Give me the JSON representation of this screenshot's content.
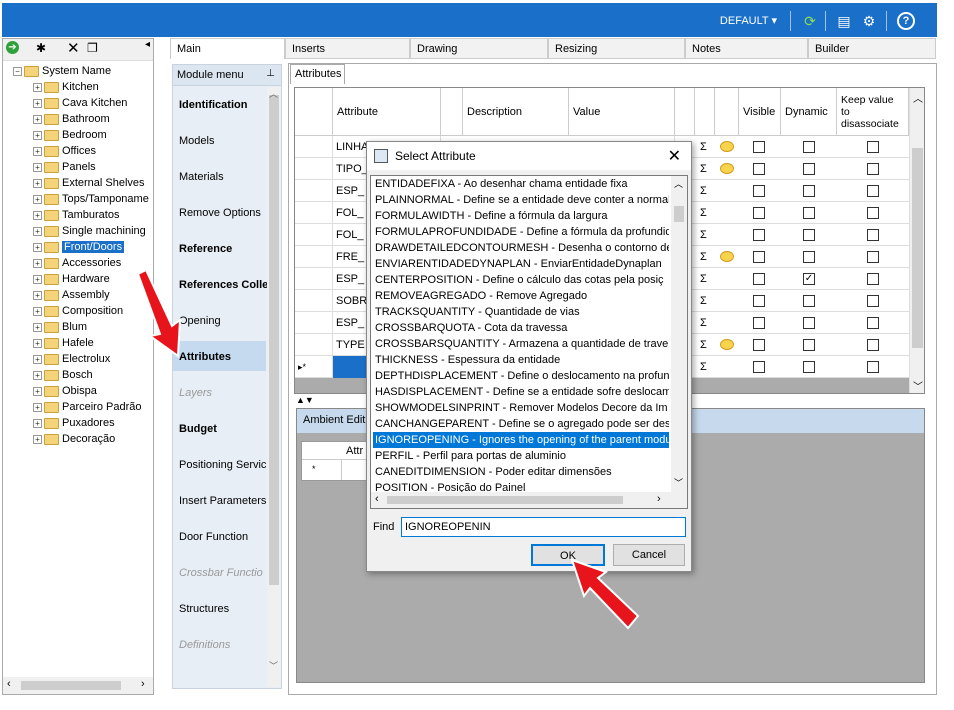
{
  "topbar": {
    "profile_label": "DEFAULT",
    "icons": [
      "refresh-icon",
      "layout-icon",
      "settings-icon",
      "help-icon"
    ]
  },
  "tree": {
    "root": "System Name",
    "items": [
      "Kitchen",
      "Cava Kitchen",
      "Bathroom",
      "Bedroom",
      "Offices",
      "Panels",
      "External Shelves",
      "Tops/Tamponame",
      "Tamburatos",
      "Single machining",
      "Front/Doors",
      "Accessories",
      "Hardware",
      "Assembly",
      "Composition",
      "Blum",
      "Hafele",
      "Electrolux",
      "Bosch",
      "Obispa",
      "Parceiro Padrão",
      "Puxadores",
      "Decoração"
    ],
    "selected": "Front/Doors"
  },
  "tabs": [
    "Main",
    "Inserts",
    "Drawing",
    "Resizing",
    "Notes",
    "Builder"
  ],
  "module_menu": {
    "header": "Module menu",
    "items": [
      {
        "label": "Identification",
        "style": "bold"
      },
      {
        "label": "Models",
        "style": "normal"
      },
      {
        "label": "Materials",
        "style": "normal"
      },
      {
        "label": "Remove Options",
        "style": "normal"
      },
      {
        "label": "Reference",
        "style": "bold"
      },
      {
        "label": "References Colle",
        "style": "bold"
      },
      {
        "label": "Opening",
        "style": "normal"
      },
      {
        "label": "Attributes",
        "style": "bold-selected"
      },
      {
        "label": "Layers",
        "style": "disabled"
      },
      {
        "label": "Budget",
        "style": "bold"
      },
      {
        "label": "Positioning Servic",
        "style": "normal"
      },
      {
        "label": "Insert Parameters",
        "style": "normal"
      },
      {
        "label": "Door Function",
        "style": "normal"
      },
      {
        "label": "Crossbar Functio",
        "style": "disabled"
      },
      {
        "label": "Structures",
        "style": "normal"
      },
      {
        "label": "Definitions",
        "style": "disabled"
      }
    ]
  },
  "attributes_tab": "Attributes",
  "grid": {
    "headers": {
      "attribute": "Attribute",
      "description": "Description",
      "value": "Value",
      "visible": "Visible",
      "dynamic": "Dynamic",
      "keep": "Keep value to disassociate"
    },
    "rows": [
      {
        "attr": "LINHA",
        "bubble": true,
        "dynamic": false
      },
      {
        "attr": "TIPO_",
        "bubble": true,
        "dynamic": false
      },
      {
        "attr": "ESP_",
        "bubble": false,
        "dynamic": false
      },
      {
        "attr": "FOL_",
        "bubble": false,
        "dynamic": false
      },
      {
        "attr": "FOL_",
        "bubble": false,
        "dynamic": false
      },
      {
        "attr": "FRE_",
        "bubble": true,
        "dynamic": false
      },
      {
        "attr": "ESP_",
        "bubble": false,
        "dynamic": true
      },
      {
        "attr": "SOBR",
        "bubble": false,
        "dynamic": false
      },
      {
        "attr": "ESP_",
        "bubble": false,
        "dynamic": false
      },
      {
        "attr": "TYPE",
        "bubble": true,
        "dynamic": false
      }
    ],
    "new_row_marker": "▸*"
  },
  "ambient": {
    "header": "Ambient Edit",
    "col": "Attr",
    "row_marker": "*"
  },
  "dialog": {
    "title": "Select Attribute",
    "items": [
      "ENTIDADEFIXA - Ao desenhar chama entidade fixa",
      "PLAINNORMAL - Define se a entidade deve conter a normal",
      "FORMULAWIDTH - Define a fórmula da largura",
      "FORMULAPROFUNDIDADE - Define a fórmula da profundid",
      "DRAWDETAILEDCONTOURMESH - Desenha o contorno de",
      "ENVIARENTIDADEDYNAPLAN - EnviarEntidadeDynaplan",
      "CENTERPOSITION - Define o cálculo das cotas pela posiç",
      "REMOVEAGREGADO - Remove Agregado",
      "TRACKSQUANTITY - Quantidade de vias",
      "CROSSBARQUOTA - Cota da travessa",
      "CROSSBARSQUANTITY - Armazena a quantidade de trave",
      "THICKNESS - Espessura da entidade",
      "DEPTHDISPLACEMENT - Define o deslocamento na profun",
      "HASDISPLACEMENT - Define se a entidade sofre deslocam",
      "SHOWMODELSINPRINT - Remover Modelos Decore da Im",
      "CANCHANGEPARENT - Define se o agregado pode ser des",
      "IGNOREOPENING - Ignores the opening of the parent modu",
      "PERFIL - Perfil para portas de aluminio",
      "CANEDITDIMENSION - Poder editar dimensões",
      "POSITION - Posição do Painel"
    ],
    "selected_index": 16,
    "find_label": "Find",
    "find_value": "IGNOREOPENIN",
    "ok_label": "OK",
    "cancel_label": "Cancel"
  },
  "colors": {
    "accent": "#1a6fc9",
    "arrow": "#e8141b",
    "selection": "#0078d7"
  }
}
